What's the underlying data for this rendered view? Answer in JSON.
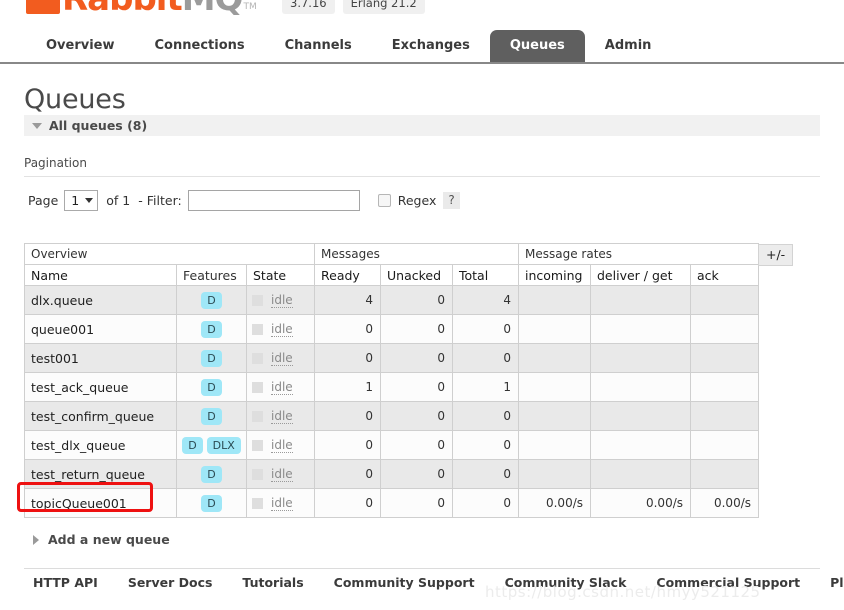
{
  "header": {
    "logo_text_left": "Rabbit",
    "logo_text_right": "MQ",
    "logo_tm": "TM",
    "version": "3.7.16",
    "erlang_version": "Erlang 21.2"
  },
  "tabs": [
    {
      "label": "Overview",
      "active": false
    },
    {
      "label": "Connections",
      "active": false
    },
    {
      "label": "Channels",
      "active": false
    },
    {
      "label": "Exchanges",
      "active": false
    },
    {
      "label": "Queues",
      "active": true
    },
    {
      "label": "Admin",
      "active": false
    }
  ],
  "page": {
    "title": "Queues",
    "section_label": "All queues (8)",
    "pagination_heading": "Pagination",
    "add_new_label": "Add a new queue"
  },
  "pagination": {
    "page_label": "Page",
    "page_value": "1",
    "of_label": "of 1",
    "dash": "-",
    "filter_label": "Filter:",
    "filter_value": "",
    "filter_placeholder": "",
    "regex_label": "Regex",
    "help_label": "?",
    "regex_checked": false
  },
  "table": {
    "toggle_label": "+/-",
    "group_headers": [
      {
        "label": "Overview",
        "colspan": 3
      },
      {
        "label": "Messages",
        "colspan": 3
      },
      {
        "label": "Message rates",
        "colspan": 3
      }
    ],
    "columns": [
      {
        "label": "Name",
        "bold": true,
        "align": "left"
      },
      {
        "label": "Features",
        "bold": false,
        "align": "left"
      },
      {
        "label": "State",
        "bold": true,
        "align": "left"
      },
      {
        "label": "Ready",
        "bold": true,
        "align": "left"
      },
      {
        "label": "Unacked",
        "bold": true,
        "align": "left"
      },
      {
        "label": "Total",
        "bold": true,
        "align": "left"
      },
      {
        "label": "incoming",
        "bold": true,
        "align": "left"
      },
      {
        "label": "deliver / get",
        "bold": true,
        "align": "left"
      },
      {
        "label": "ack",
        "bold": true,
        "align": "left"
      }
    ],
    "rows": [
      {
        "name": "dlx.queue",
        "features": [
          "D"
        ],
        "state": "idle",
        "ready": "4",
        "unacked": "0",
        "total": "4",
        "incoming": "",
        "deliver_get": "",
        "ack": "",
        "highlighted": false
      },
      {
        "name": "queue001",
        "features": [
          "D"
        ],
        "state": "idle",
        "ready": "0",
        "unacked": "0",
        "total": "0",
        "incoming": "",
        "deliver_get": "",
        "ack": "",
        "highlighted": false
      },
      {
        "name": "test001",
        "features": [
          "D"
        ],
        "state": "idle",
        "ready": "0",
        "unacked": "0",
        "total": "0",
        "incoming": "",
        "deliver_get": "",
        "ack": "",
        "highlighted": false
      },
      {
        "name": "test_ack_queue",
        "features": [
          "D"
        ],
        "state": "idle",
        "ready": "1",
        "unacked": "0",
        "total": "1",
        "incoming": "",
        "deliver_get": "",
        "ack": "",
        "highlighted": false
      },
      {
        "name": "test_confirm_queue",
        "features": [
          "D"
        ],
        "state": "idle",
        "ready": "0",
        "unacked": "0",
        "total": "0",
        "incoming": "",
        "deliver_get": "",
        "ack": "",
        "highlighted": false
      },
      {
        "name": "test_dlx_queue",
        "features": [
          "D",
          "DLX"
        ],
        "state": "idle",
        "ready": "0",
        "unacked": "0",
        "total": "0",
        "incoming": "",
        "deliver_get": "",
        "ack": "",
        "highlighted": false
      },
      {
        "name": "test_return_queue",
        "features": [
          "D"
        ],
        "state": "idle",
        "ready": "0",
        "unacked": "0",
        "total": "0",
        "incoming": "",
        "deliver_get": "",
        "ack": "",
        "highlighted": false
      },
      {
        "name": "topicQueue001",
        "features": [
          "D"
        ],
        "state": "idle",
        "ready": "0",
        "unacked": "0",
        "total": "0",
        "incoming": "0.00/s",
        "deliver_get": "0.00/s",
        "ack": "0.00/s",
        "highlighted": true
      }
    ]
  },
  "footer": {
    "links": [
      "HTTP API",
      "Server Docs",
      "Tutorials",
      "Community Support",
      "Community Slack",
      "Commercial Support",
      "Plugins"
    ],
    "watermark": "https://blog.csdn.net/hmyy521125"
  },
  "colors": {
    "brand_orange": "#f25c1f",
    "active_tab": "#5f5f5f",
    "feature_badge": "#9fe7f7",
    "annotation_red": "#ee1111"
  }
}
